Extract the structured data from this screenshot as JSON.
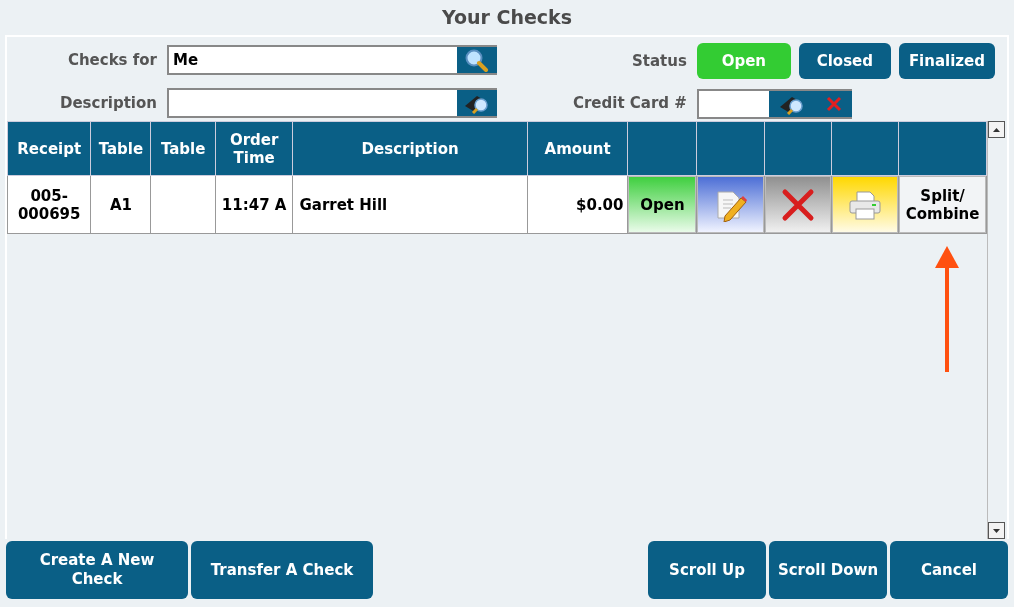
{
  "title": "Your Checks",
  "filters": {
    "checks_for": {
      "label": "Checks for",
      "value": "Me"
    },
    "description": {
      "label": "Description"
    },
    "status": {
      "label": "Status",
      "options": [
        {
          "label": "Open",
          "selected": true
        },
        {
          "label": "Closed",
          "selected": false
        },
        {
          "label": "Finalized",
          "selected": false
        }
      ]
    },
    "credit_card": {
      "label": "Credit Card #"
    }
  },
  "table": {
    "columns": [
      "Receipt",
      "Table",
      "Table",
      "Order Time",
      "Description",
      "Amount"
    ],
    "rows": [
      {
        "receipt": "005-000695",
        "table": "A1",
        "order_time": "11:47 A",
        "description": "Garret Hill",
        "amount": "$0.00",
        "actions": [
          {
            "kind": "open",
            "label": "Open"
          },
          {
            "kind": "edit"
          },
          {
            "kind": "delete"
          },
          {
            "kind": "print"
          },
          {
            "kind": "split",
            "label": "Split/Combine"
          }
        ]
      }
    ]
  },
  "footer": {
    "left": [
      "Create A New Check",
      "Transfer A Check"
    ],
    "right": [
      "Scroll Up",
      "Scroll Down",
      "Cancel"
    ]
  }
}
